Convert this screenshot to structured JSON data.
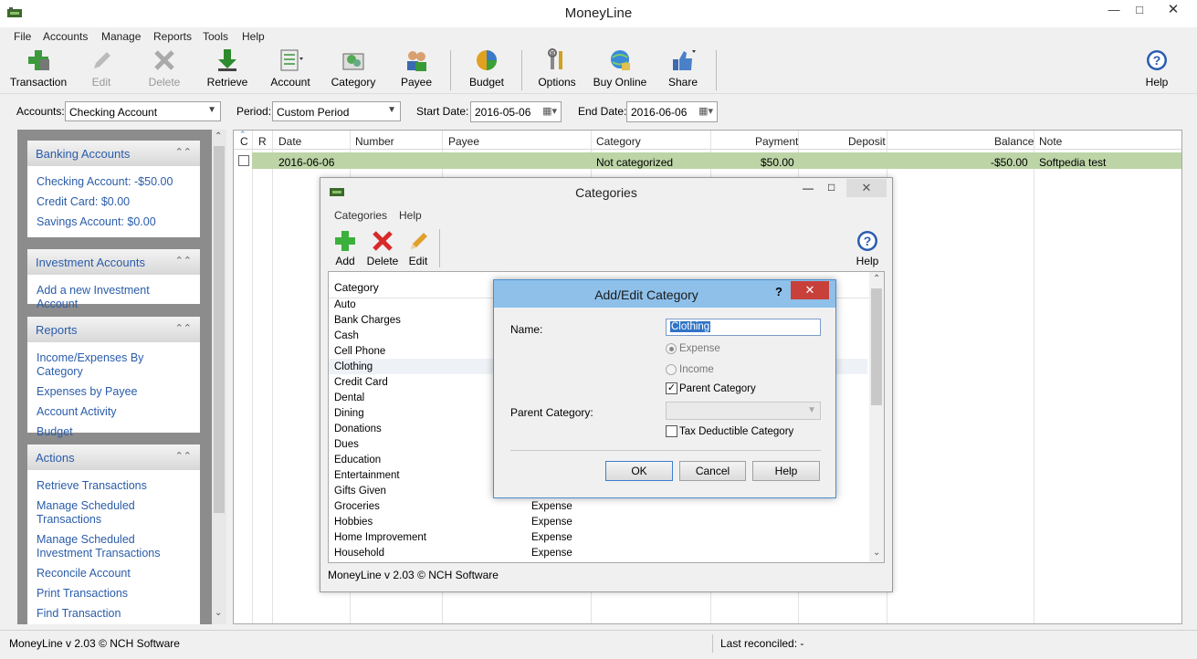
{
  "app": {
    "title": "MoneyLine"
  },
  "menu": [
    "File",
    "Accounts",
    "Manage",
    "Reports",
    "Tools",
    "Help"
  ],
  "toolbar": {
    "transaction": "Transaction",
    "edit": "Edit",
    "delete": "Delete",
    "retrieve": "Retrieve",
    "account": "Account",
    "category": "Category",
    "payee": "Payee",
    "budget": "Budget",
    "options": "Options",
    "buy_online": "Buy Online",
    "share": "Share",
    "help": "Help"
  },
  "filters": {
    "accounts_label": "Accounts:",
    "accounts_value": "Checking Account",
    "period_label": "Period:",
    "period_value": "Custom Period",
    "start_label": "Start Date:",
    "start_value": "2016-05-06",
    "end_label": "End Date:",
    "end_value": "2016-06-06"
  },
  "sidebar": {
    "banking": {
      "title": "Banking Accounts",
      "items": [
        "Checking Account: -$50.00",
        "Credit Card: $0.00",
        "Savings Account: $0.00"
      ]
    },
    "investment": {
      "title": "Investment Accounts",
      "items": [
        "Add a new Investment Account"
      ]
    },
    "reports": {
      "title": "Reports",
      "items": [
        "Income/Expenses By Category",
        "Expenses by Payee",
        "Account Activity",
        "Budget"
      ]
    },
    "actions": {
      "title": "Actions",
      "items": [
        "Retrieve Transactions",
        "Manage Scheduled Transactions",
        "Manage Scheduled Investment Transactions",
        "Reconcile Account",
        "Print Transactions",
        "Find Transaction"
      ]
    }
  },
  "grid": {
    "headers": [
      "C",
      "R",
      "Date",
      "Number",
      "Payee",
      "Category",
      "Payment",
      "Deposit",
      "Balance",
      "Note"
    ],
    "rows": [
      {
        "date": "2016-06-06",
        "number": "",
        "payee": "",
        "category": "Not categorized",
        "payment": "$50.00",
        "deposit": "",
        "balance": "-$50.00",
        "note": "Softpedia test"
      }
    ]
  },
  "categories_window": {
    "title": "Categories",
    "menu": [
      "Categories",
      "Help"
    ],
    "buttons": {
      "add": "Add",
      "delete": "Delete",
      "edit": "Edit",
      "help": "Help"
    },
    "list_header": "Category",
    "items": [
      {
        "name": "Auto",
        "type": ""
      },
      {
        "name": "Bank Charges",
        "type": ""
      },
      {
        "name": "Cash",
        "type": ""
      },
      {
        "name": "Cell Phone",
        "type": ""
      },
      {
        "name": "Clothing",
        "type": ""
      },
      {
        "name": "Credit Card",
        "type": ""
      },
      {
        "name": "Dental",
        "type": ""
      },
      {
        "name": "Dining",
        "type": ""
      },
      {
        "name": "Donations",
        "type": ""
      },
      {
        "name": "Dues",
        "type": ""
      },
      {
        "name": "Education",
        "type": ""
      },
      {
        "name": "Entertainment",
        "type": ""
      },
      {
        "name": "Gifts Given",
        "type": ""
      },
      {
        "name": "Groceries",
        "type": "Expense"
      },
      {
        "name": "Hobbies",
        "type": "Expense"
      },
      {
        "name": "Home Improvement",
        "type": "Expense"
      },
      {
        "name": "Household",
        "type": "Expense"
      }
    ],
    "status": "MoneyLine v 2.03 © NCH Software"
  },
  "dialog": {
    "title": "Add/Edit Category",
    "help_glyph": "?",
    "name_label": "Name:",
    "name_value": "Clothing",
    "expense_label": "Expense",
    "income_label": "Income",
    "parent_checkbox_label": "Parent Category",
    "parent_label": "Parent Category:",
    "tax_label": "Tax Deductible Category",
    "ok": "OK",
    "cancel": "Cancel",
    "help": "Help"
  },
  "status": {
    "left": "MoneyLine v 2.03 © NCH Software",
    "right": "Last reconciled: -"
  },
  "colors": {
    "row_highlight": "#bcd4a6",
    "link": "#2a5caa",
    "dialog_titlebar": "#8ec0ea",
    "close_button": "#c7403a"
  }
}
